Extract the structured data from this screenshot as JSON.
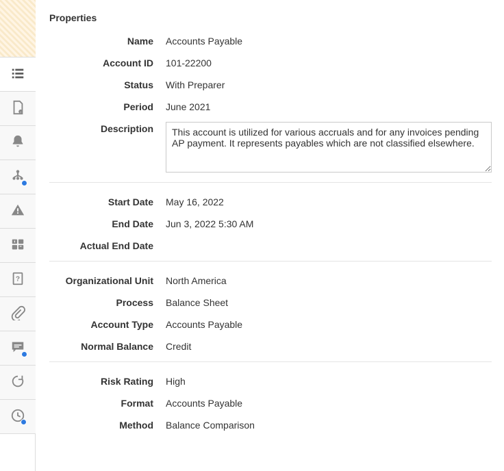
{
  "panel_title": "Properties",
  "labels": {
    "name": "Name",
    "account_id": "Account ID",
    "status": "Status",
    "period": "Period",
    "description": "Description",
    "start_date": "Start Date",
    "end_date": "End Date",
    "actual_end_date": "Actual End Date",
    "org_unit": "Organizational Unit",
    "process": "Process",
    "account_type": "Account Type",
    "normal_balance": "Normal Balance",
    "risk_rating": "Risk Rating",
    "format": "Format",
    "method": "Method"
  },
  "values": {
    "name": "Accounts Payable",
    "account_id": "101-22200",
    "status": "With Preparer",
    "period": "June 2021",
    "description": "This account is utilized for various accruals and for any invoices pending AP payment. It represents payables which are not classified elsewhere.",
    "start_date": "May 16, 2022",
    "end_date": "Jun 3, 2022 5:30 AM",
    "actual_end_date": "",
    "org_unit": "North America",
    "process": "Balance Sheet",
    "account_type": "Accounts Payable",
    "normal_balance": "Credit",
    "risk_rating": "High",
    "format": "Accounts Payable",
    "method": "Balance Comparison"
  }
}
